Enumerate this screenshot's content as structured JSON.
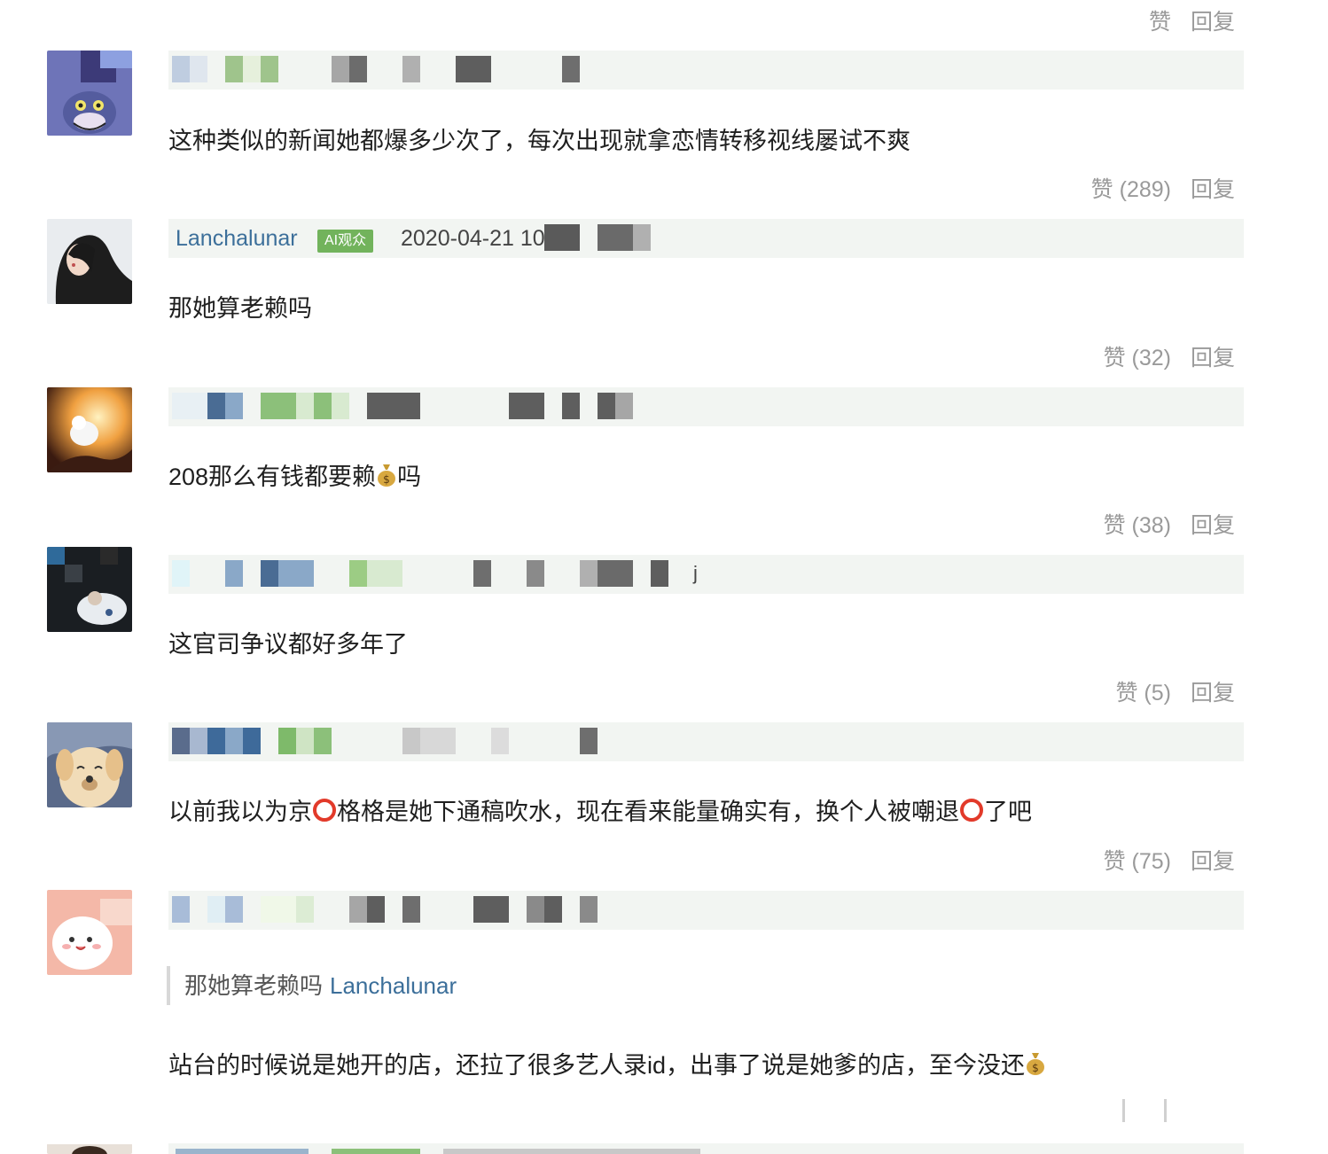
{
  "labels": {
    "like": "赞",
    "reply": "回复"
  },
  "top_actions": {
    "like": "赞",
    "reply": "回复"
  },
  "comments": [
    {
      "text": "这种类似的新闻她都爆多少次了，每次出现就拿恋情转移视线屡试不爽",
      "like": "赞 (289)",
      "reply": "回复"
    },
    {
      "username": "Lanchalunar",
      "badge": "AI观众",
      "date": "2020-04-21 10:35",
      "text": "那她算老赖吗",
      "like": "赞 (32)",
      "reply": "回复"
    },
    {
      "text_a": "208那么有钱都要赖",
      "text_b": "吗",
      "emoji": "money-bag",
      "like": "赞 (38)",
      "reply": "回复"
    },
    {
      "trail": "j",
      "text": "这官司争议都好多年了",
      "like": "赞 (5)",
      "reply": "回复"
    },
    {
      "text_a": "以前我以为京",
      "text_b": "格格是她下通稿吹水，现在看来能量确实有，换个人被嘲退",
      "text_c": "了吧",
      "emoji": "red-circle",
      "like": "赞 (75)",
      "reply": "回复"
    },
    {
      "quote_text": "那她算老赖吗",
      "quote_user": "Lanchalunar",
      "text": "站台的时候说是她开的店，还拉了很多艺人录id，出事了说是她爹的店，至今没还",
      "emoji": "money-bag"
    }
  ],
  "colors": {
    "username": "#3c6f9a",
    "badge": "#72b35c",
    "action": "#9a9a9a",
    "strip": "#f2f5f2"
  }
}
